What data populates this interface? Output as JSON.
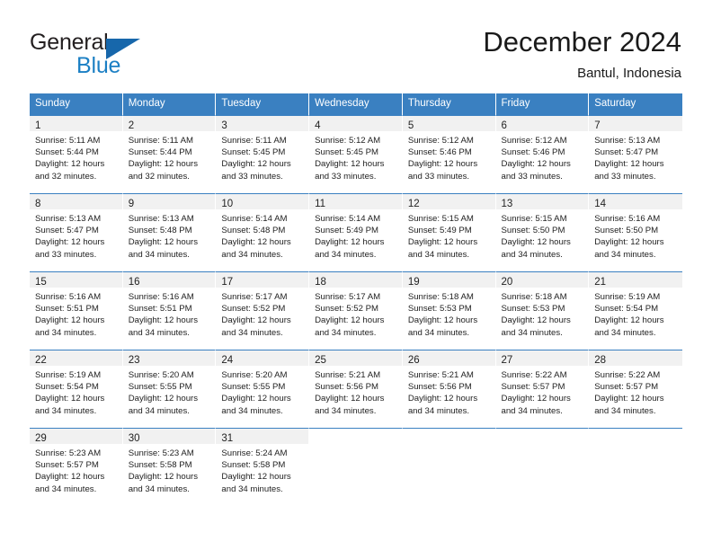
{
  "logo": {
    "word_one": "General",
    "word_two": "Blue",
    "triangle_icon": "blue-triangle-icon"
  },
  "header": {
    "title": "December 2024",
    "subtitle": "Bantul, Indonesia"
  },
  "colors": {
    "header_blue": "#3a80c1",
    "logo_blue": "#1b7fc4",
    "daynum_band": "#f1f1f1",
    "text": "#222222"
  },
  "calendar": {
    "weekdays": [
      "Sunday",
      "Monday",
      "Tuesday",
      "Wednesday",
      "Thursday",
      "Friday",
      "Saturday"
    ],
    "weeks": [
      [
        {
          "day": "1",
          "sunrise": "Sunrise: 5:11 AM",
          "sunset": "Sunset: 5:44 PM",
          "daylight_1": "Daylight: 12 hours",
          "daylight_2": "and 32 minutes."
        },
        {
          "day": "2",
          "sunrise": "Sunrise: 5:11 AM",
          "sunset": "Sunset: 5:44 PM",
          "daylight_1": "Daylight: 12 hours",
          "daylight_2": "and 32 minutes."
        },
        {
          "day": "3",
          "sunrise": "Sunrise: 5:11 AM",
          "sunset": "Sunset: 5:45 PM",
          "daylight_1": "Daylight: 12 hours",
          "daylight_2": "and 33 minutes."
        },
        {
          "day": "4",
          "sunrise": "Sunrise: 5:12 AM",
          "sunset": "Sunset: 5:45 PM",
          "daylight_1": "Daylight: 12 hours",
          "daylight_2": "and 33 minutes."
        },
        {
          "day": "5",
          "sunrise": "Sunrise: 5:12 AM",
          "sunset": "Sunset: 5:46 PM",
          "daylight_1": "Daylight: 12 hours",
          "daylight_2": "and 33 minutes."
        },
        {
          "day": "6",
          "sunrise": "Sunrise: 5:12 AM",
          "sunset": "Sunset: 5:46 PM",
          "daylight_1": "Daylight: 12 hours",
          "daylight_2": "and 33 minutes."
        },
        {
          "day": "7",
          "sunrise": "Sunrise: 5:13 AM",
          "sunset": "Sunset: 5:47 PM",
          "daylight_1": "Daylight: 12 hours",
          "daylight_2": "and 33 minutes."
        }
      ],
      [
        {
          "day": "8",
          "sunrise": "Sunrise: 5:13 AM",
          "sunset": "Sunset: 5:47 PM",
          "daylight_1": "Daylight: 12 hours",
          "daylight_2": "and 33 minutes."
        },
        {
          "day": "9",
          "sunrise": "Sunrise: 5:13 AM",
          "sunset": "Sunset: 5:48 PM",
          "daylight_1": "Daylight: 12 hours",
          "daylight_2": "and 34 minutes."
        },
        {
          "day": "10",
          "sunrise": "Sunrise: 5:14 AM",
          "sunset": "Sunset: 5:48 PM",
          "daylight_1": "Daylight: 12 hours",
          "daylight_2": "and 34 minutes."
        },
        {
          "day": "11",
          "sunrise": "Sunrise: 5:14 AM",
          "sunset": "Sunset: 5:49 PM",
          "daylight_1": "Daylight: 12 hours",
          "daylight_2": "and 34 minutes."
        },
        {
          "day": "12",
          "sunrise": "Sunrise: 5:15 AM",
          "sunset": "Sunset: 5:49 PM",
          "daylight_1": "Daylight: 12 hours",
          "daylight_2": "and 34 minutes."
        },
        {
          "day": "13",
          "sunrise": "Sunrise: 5:15 AM",
          "sunset": "Sunset: 5:50 PM",
          "daylight_1": "Daylight: 12 hours",
          "daylight_2": "and 34 minutes."
        },
        {
          "day": "14",
          "sunrise": "Sunrise: 5:16 AM",
          "sunset": "Sunset: 5:50 PM",
          "daylight_1": "Daylight: 12 hours",
          "daylight_2": "and 34 minutes."
        }
      ],
      [
        {
          "day": "15",
          "sunrise": "Sunrise: 5:16 AM",
          "sunset": "Sunset: 5:51 PM",
          "daylight_1": "Daylight: 12 hours",
          "daylight_2": "and 34 minutes."
        },
        {
          "day": "16",
          "sunrise": "Sunrise: 5:16 AM",
          "sunset": "Sunset: 5:51 PM",
          "daylight_1": "Daylight: 12 hours",
          "daylight_2": "and 34 minutes."
        },
        {
          "day": "17",
          "sunrise": "Sunrise: 5:17 AM",
          "sunset": "Sunset: 5:52 PM",
          "daylight_1": "Daylight: 12 hours",
          "daylight_2": "and 34 minutes."
        },
        {
          "day": "18",
          "sunrise": "Sunrise: 5:17 AM",
          "sunset": "Sunset: 5:52 PM",
          "daylight_1": "Daylight: 12 hours",
          "daylight_2": "and 34 minutes."
        },
        {
          "day": "19",
          "sunrise": "Sunrise: 5:18 AM",
          "sunset": "Sunset: 5:53 PM",
          "daylight_1": "Daylight: 12 hours",
          "daylight_2": "and 34 minutes."
        },
        {
          "day": "20",
          "sunrise": "Sunrise: 5:18 AM",
          "sunset": "Sunset: 5:53 PM",
          "daylight_1": "Daylight: 12 hours",
          "daylight_2": "and 34 minutes."
        },
        {
          "day": "21",
          "sunrise": "Sunrise: 5:19 AM",
          "sunset": "Sunset: 5:54 PM",
          "daylight_1": "Daylight: 12 hours",
          "daylight_2": "and 34 minutes."
        }
      ],
      [
        {
          "day": "22",
          "sunrise": "Sunrise: 5:19 AM",
          "sunset": "Sunset: 5:54 PM",
          "daylight_1": "Daylight: 12 hours",
          "daylight_2": "and 34 minutes."
        },
        {
          "day": "23",
          "sunrise": "Sunrise: 5:20 AM",
          "sunset": "Sunset: 5:55 PM",
          "daylight_1": "Daylight: 12 hours",
          "daylight_2": "and 34 minutes."
        },
        {
          "day": "24",
          "sunrise": "Sunrise: 5:20 AM",
          "sunset": "Sunset: 5:55 PM",
          "daylight_1": "Daylight: 12 hours",
          "daylight_2": "and 34 minutes."
        },
        {
          "day": "25",
          "sunrise": "Sunrise: 5:21 AM",
          "sunset": "Sunset: 5:56 PM",
          "daylight_1": "Daylight: 12 hours",
          "daylight_2": "and 34 minutes."
        },
        {
          "day": "26",
          "sunrise": "Sunrise: 5:21 AM",
          "sunset": "Sunset: 5:56 PM",
          "daylight_1": "Daylight: 12 hours",
          "daylight_2": "and 34 minutes."
        },
        {
          "day": "27",
          "sunrise": "Sunrise: 5:22 AM",
          "sunset": "Sunset: 5:57 PM",
          "daylight_1": "Daylight: 12 hours",
          "daylight_2": "and 34 minutes."
        },
        {
          "day": "28",
          "sunrise": "Sunrise: 5:22 AM",
          "sunset": "Sunset: 5:57 PM",
          "daylight_1": "Daylight: 12 hours",
          "daylight_2": "and 34 minutes."
        }
      ],
      [
        {
          "day": "29",
          "sunrise": "Sunrise: 5:23 AM",
          "sunset": "Sunset: 5:57 PM",
          "daylight_1": "Daylight: 12 hours",
          "daylight_2": "and 34 minutes."
        },
        {
          "day": "30",
          "sunrise": "Sunrise: 5:23 AM",
          "sunset": "Sunset: 5:58 PM",
          "daylight_1": "Daylight: 12 hours",
          "daylight_2": "and 34 minutes."
        },
        {
          "day": "31",
          "sunrise": "Sunrise: 5:24 AM",
          "sunset": "Sunset: 5:58 PM",
          "daylight_1": "Daylight: 12 hours",
          "daylight_2": "and 34 minutes."
        },
        {
          "day": "",
          "sunrise": "",
          "sunset": "",
          "daylight_1": "",
          "daylight_2": ""
        },
        {
          "day": "",
          "sunrise": "",
          "sunset": "",
          "daylight_1": "",
          "daylight_2": ""
        },
        {
          "day": "",
          "sunrise": "",
          "sunset": "",
          "daylight_1": "",
          "daylight_2": ""
        },
        {
          "day": "",
          "sunrise": "",
          "sunset": "",
          "daylight_1": "",
          "daylight_2": ""
        }
      ]
    ]
  }
}
